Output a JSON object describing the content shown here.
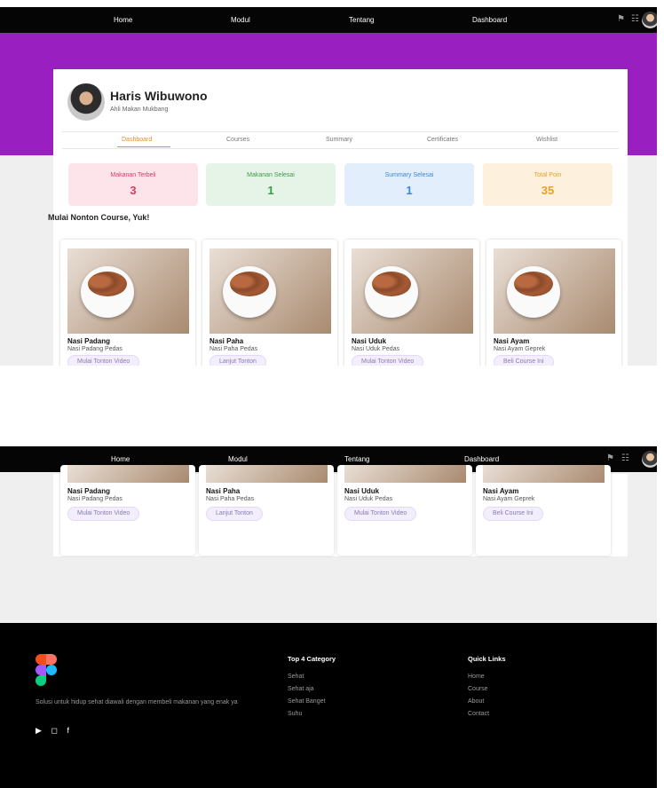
{
  "nav": {
    "items": [
      "Home",
      "Modul",
      "Tentang",
      "Dashboard"
    ],
    "icons": [
      "bell-icon",
      "cart-icon",
      "avatar"
    ]
  },
  "profile": {
    "name": "Haris Wibuwono",
    "subtitle": "Ahli Makan Mukbang"
  },
  "tabs": [
    "Dashboard",
    "Courses",
    "Summary",
    "Certificates",
    "Wishlist"
  ],
  "stats": [
    {
      "label": "Makanan Terbeli",
      "value": "3",
      "bg": "#fde4ea",
      "color": "#d93a63"
    },
    {
      "label": "Makanan Selesai",
      "value": "1",
      "bg": "#e6f4e8",
      "color": "#3a9b4a"
    },
    {
      "label": "Summary Selesai",
      "value": "1",
      "bg": "#e2eefb",
      "color": "#3a8ad9"
    },
    {
      "label": "Total Poin",
      "value": "35",
      "bg": "#fdf0dc",
      "color": "#e8a02a"
    }
  ],
  "section_title": "Mulai Nonton Course, Yuk!",
  "courses": [
    {
      "title": "Nasi Padang",
      "subtitle": "Nasi Padang Pedas",
      "button": "Mulai Tonton Video"
    },
    {
      "title": "Nasi Paha",
      "subtitle": "Nasi Paha Pedas",
      "button": "Lanjut Tonton"
    },
    {
      "title": "Nasi Uduk",
      "subtitle": "Nasi Uduk Pedas",
      "button": "Mulai Tonton Video"
    },
    {
      "title": "Nasi Ayam",
      "subtitle": "Nasi Ayam Geprek",
      "button": "Beli Course Ini"
    }
  ],
  "footer": {
    "tagline": "Solusi untuk hidup sehat diawali dengan membeli makanan yang enak ya",
    "social_icons": [
      "youtube-icon",
      "instagram-icon",
      "facebook-icon"
    ],
    "category_heading": "Top 4 Category",
    "categories": [
      "Sehat",
      "Sehat aja",
      "Sehat Banget",
      "Suhu"
    ],
    "links_heading": "Quick Links",
    "links": [
      "Home",
      "Course",
      "About",
      "Contact"
    ]
  },
  "colors": {
    "hero": "#9a1fc0",
    "nav_bg": "#050505",
    "accent": "#e0902a"
  }
}
